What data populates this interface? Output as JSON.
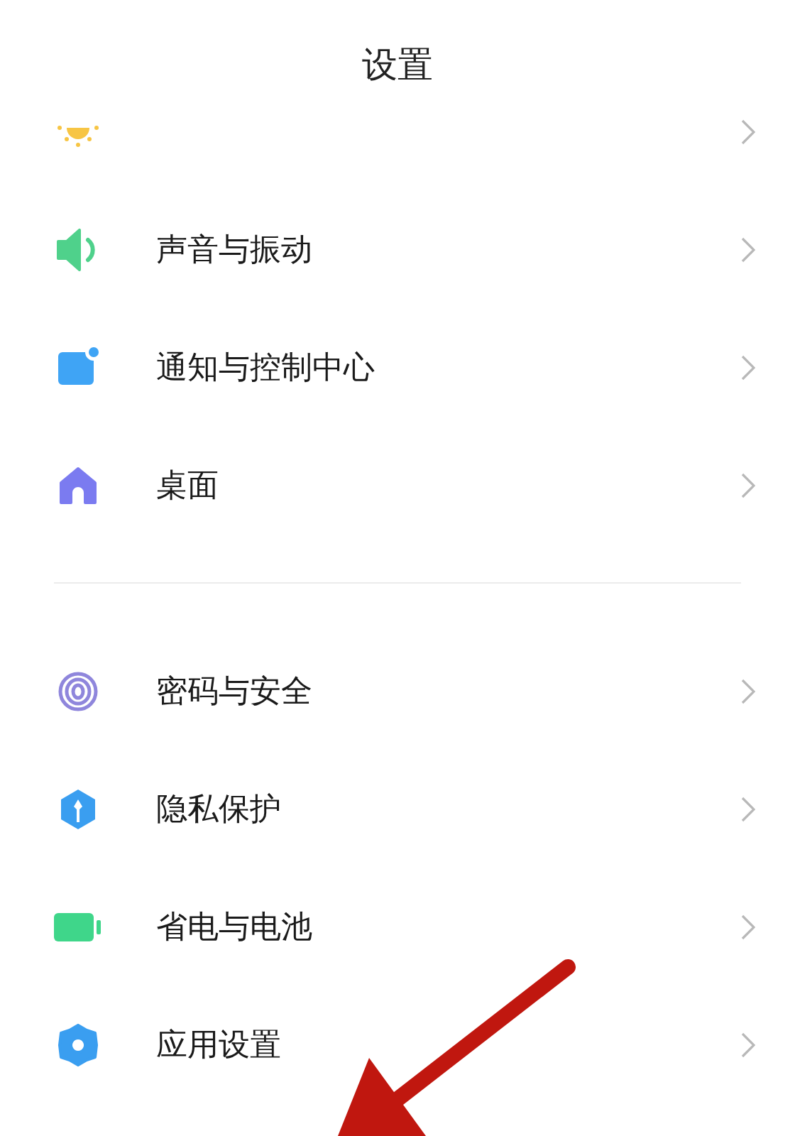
{
  "header": {
    "title": "设置"
  },
  "partial_item": {
    "kind": "sun"
  },
  "groups": [
    {
      "items": [
        {
          "label": "声音与振动",
          "kind": "speaker"
        },
        {
          "label": "通知与控制中心",
          "kind": "notification"
        },
        {
          "label": "桌面",
          "kind": "home"
        }
      ]
    },
    {
      "items": [
        {
          "label": "密码与安全",
          "kind": "fingerprint"
        },
        {
          "label": "隐私保护",
          "kind": "shield"
        },
        {
          "label": "省电与电池",
          "kind": "battery"
        },
        {
          "label": "应用设置",
          "kind": "gear"
        }
      ]
    }
  ],
  "annotation": {
    "kind": "arrow"
  }
}
